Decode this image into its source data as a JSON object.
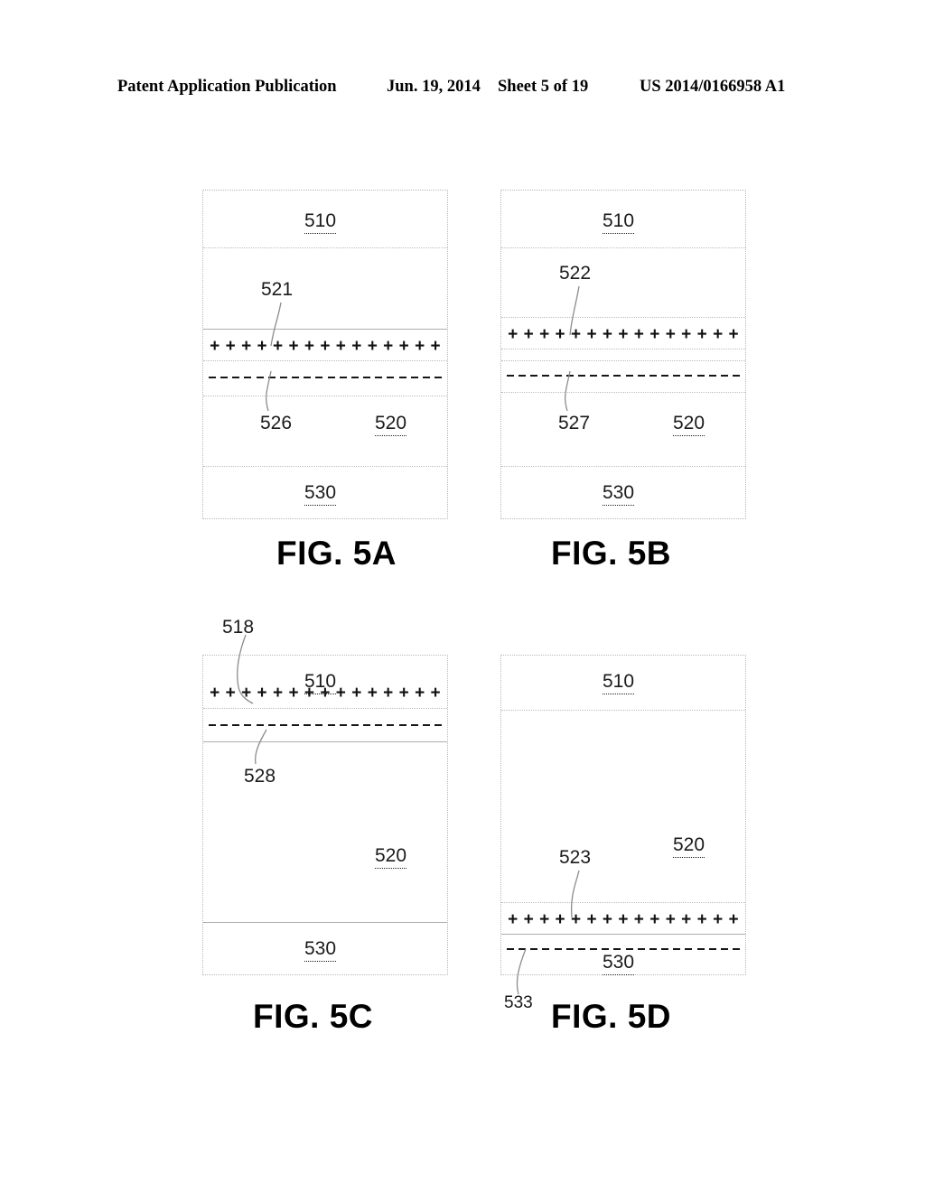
{
  "header": {
    "publication": "Patent Application Publication",
    "date": "Jun. 19, 2014",
    "sheet": "Sheet 5 of 19",
    "document_number": "US 2014/0166958 A1"
  },
  "figures": [
    {
      "id": "fig-5a",
      "caption": "FIG. 5A",
      "layers": [
        {
          "label": "510"
        },
        {
          "label": "520"
        },
        {
          "label": "530"
        }
      ],
      "labels": {
        "top_layer": "510",
        "middle_layer": "520",
        "bottom_layer": "530",
        "positive_charge_callout": "521",
        "negative_charge_callout": "526"
      },
      "charge_rows": {
        "positive_count": 15,
        "positive_glyph": "+",
        "negative_count": 20
      }
    },
    {
      "id": "fig-5b",
      "caption": "FIG. 5B",
      "layers": [
        {
          "label": "510"
        },
        {
          "label": "520"
        },
        {
          "label": "530"
        }
      ],
      "labels": {
        "top_layer": "510",
        "middle_layer": "520",
        "bottom_layer": "530",
        "positive_charge_callout": "522",
        "negative_charge_callout": "527"
      },
      "charge_rows": {
        "positive_count": 15,
        "positive_glyph": "+",
        "negative_count": 20
      }
    },
    {
      "id": "fig-5c",
      "caption": "FIG. 5C",
      "layers": [
        {
          "label": "510"
        },
        {
          "label": "520"
        },
        {
          "label": "530"
        }
      ],
      "labels": {
        "top_layer": "510",
        "middle_layer": "520",
        "bottom_layer": "530",
        "positive_charge_callout": "518",
        "negative_charge_callout": "528"
      },
      "charge_rows": {
        "positive_count": 15,
        "positive_glyph": "+",
        "negative_count": 20
      }
    },
    {
      "id": "fig-5d",
      "caption": "FIG. 5D",
      "layers": [
        {
          "label": "510"
        },
        {
          "label": "520"
        },
        {
          "label": "530"
        }
      ],
      "labels": {
        "top_layer": "510",
        "middle_layer": "520",
        "bottom_layer": "530",
        "positive_charge_callout": "523",
        "negative_charge_callout": "533"
      },
      "charge_rows": {
        "positive_count": 15,
        "positive_glyph": "+",
        "negative_count": 20
      }
    }
  ],
  "colors": {
    "ink": "#000000",
    "box_border": "#b8b8b8",
    "divider": "#bdbdbd",
    "divider_solid": "#aeaeae",
    "leader_line": "#8c8c8c",
    "background": "#ffffff"
  }
}
